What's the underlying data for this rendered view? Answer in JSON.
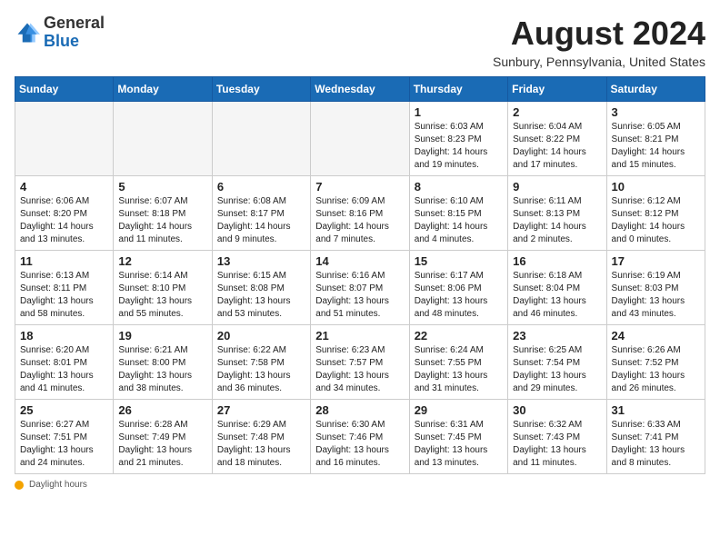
{
  "header": {
    "logo_general": "General",
    "logo_blue": "Blue",
    "month_year": "August 2024",
    "location": "Sunbury, Pennsylvania, United States"
  },
  "days_of_week": [
    "Sunday",
    "Monday",
    "Tuesday",
    "Wednesday",
    "Thursday",
    "Friday",
    "Saturday"
  ],
  "weeks": [
    [
      {
        "day": "",
        "data": ""
      },
      {
        "day": "",
        "data": ""
      },
      {
        "day": "",
        "data": ""
      },
      {
        "day": "",
        "data": ""
      },
      {
        "day": "1",
        "sunrise": "6:03 AM",
        "sunset": "8:23 PM",
        "daylight": "14 hours and 19 minutes."
      },
      {
        "day": "2",
        "sunrise": "6:04 AM",
        "sunset": "8:22 PM",
        "daylight": "14 hours and 17 minutes."
      },
      {
        "day": "3",
        "sunrise": "6:05 AM",
        "sunset": "8:21 PM",
        "daylight": "14 hours and 15 minutes."
      }
    ],
    [
      {
        "day": "4",
        "sunrise": "6:06 AM",
        "sunset": "8:20 PM",
        "daylight": "14 hours and 13 minutes."
      },
      {
        "day": "5",
        "sunrise": "6:07 AM",
        "sunset": "8:18 PM",
        "daylight": "14 hours and 11 minutes."
      },
      {
        "day": "6",
        "sunrise": "6:08 AM",
        "sunset": "8:17 PM",
        "daylight": "14 hours and 9 minutes."
      },
      {
        "day": "7",
        "sunrise": "6:09 AM",
        "sunset": "8:16 PM",
        "daylight": "14 hours and 7 minutes."
      },
      {
        "day": "8",
        "sunrise": "6:10 AM",
        "sunset": "8:15 PM",
        "daylight": "14 hours and 4 minutes."
      },
      {
        "day": "9",
        "sunrise": "6:11 AM",
        "sunset": "8:13 PM",
        "daylight": "14 hours and 2 minutes."
      },
      {
        "day": "10",
        "sunrise": "6:12 AM",
        "sunset": "8:12 PM",
        "daylight": "14 hours and 0 minutes."
      }
    ],
    [
      {
        "day": "11",
        "sunrise": "6:13 AM",
        "sunset": "8:11 PM",
        "daylight": "13 hours and 58 minutes."
      },
      {
        "day": "12",
        "sunrise": "6:14 AM",
        "sunset": "8:10 PM",
        "daylight": "13 hours and 55 minutes."
      },
      {
        "day": "13",
        "sunrise": "6:15 AM",
        "sunset": "8:08 PM",
        "daylight": "13 hours and 53 minutes."
      },
      {
        "day": "14",
        "sunrise": "6:16 AM",
        "sunset": "8:07 PM",
        "daylight": "13 hours and 51 minutes."
      },
      {
        "day": "15",
        "sunrise": "6:17 AM",
        "sunset": "8:06 PM",
        "daylight": "13 hours and 48 minutes."
      },
      {
        "day": "16",
        "sunrise": "6:18 AM",
        "sunset": "8:04 PM",
        "daylight": "13 hours and 46 minutes."
      },
      {
        "day": "17",
        "sunrise": "6:19 AM",
        "sunset": "8:03 PM",
        "daylight": "13 hours and 43 minutes."
      }
    ],
    [
      {
        "day": "18",
        "sunrise": "6:20 AM",
        "sunset": "8:01 PM",
        "daylight": "13 hours and 41 minutes."
      },
      {
        "day": "19",
        "sunrise": "6:21 AM",
        "sunset": "8:00 PM",
        "daylight": "13 hours and 38 minutes."
      },
      {
        "day": "20",
        "sunrise": "6:22 AM",
        "sunset": "7:58 PM",
        "daylight": "13 hours and 36 minutes."
      },
      {
        "day": "21",
        "sunrise": "6:23 AM",
        "sunset": "7:57 PM",
        "daylight": "13 hours and 34 minutes."
      },
      {
        "day": "22",
        "sunrise": "6:24 AM",
        "sunset": "7:55 PM",
        "daylight": "13 hours and 31 minutes."
      },
      {
        "day": "23",
        "sunrise": "6:25 AM",
        "sunset": "7:54 PM",
        "daylight": "13 hours and 29 minutes."
      },
      {
        "day": "24",
        "sunrise": "6:26 AM",
        "sunset": "7:52 PM",
        "daylight": "13 hours and 26 minutes."
      }
    ],
    [
      {
        "day": "25",
        "sunrise": "6:27 AM",
        "sunset": "7:51 PM",
        "daylight": "13 hours and 24 minutes."
      },
      {
        "day": "26",
        "sunrise": "6:28 AM",
        "sunset": "7:49 PM",
        "daylight": "13 hours and 21 minutes."
      },
      {
        "day": "27",
        "sunrise": "6:29 AM",
        "sunset": "7:48 PM",
        "daylight": "13 hours and 18 minutes."
      },
      {
        "day": "28",
        "sunrise": "6:30 AM",
        "sunset": "7:46 PM",
        "daylight": "13 hours and 16 minutes."
      },
      {
        "day": "29",
        "sunrise": "6:31 AM",
        "sunset": "7:45 PM",
        "daylight": "13 hours and 13 minutes."
      },
      {
        "day": "30",
        "sunrise": "6:32 AM",
        "sunset": "7:43 PM",
        "daylight": "13 hours and 11 minutes."
      },
      {
        "day": "31",
        "sunrise": "6:33 AM",
        "sunset": "7:41 PM",
        "daylight": "13 hours and 8 minutes."
      }
    ]
  ],
  "footer": {
    "daylight_label": "Daylight hours"
  }
}
